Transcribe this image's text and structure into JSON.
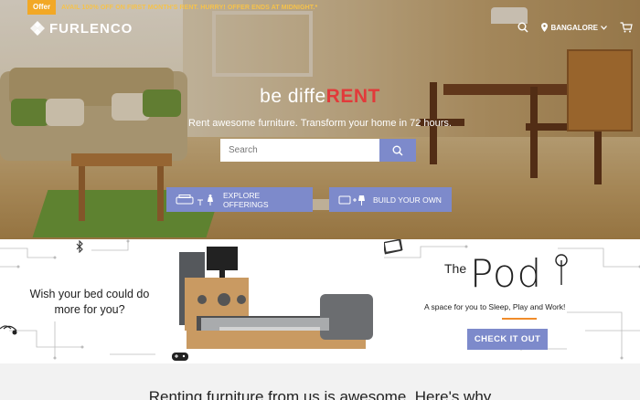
{
  "offer": {
    "tag": "Offer",
    "text": "AVAIL 100% OFF ON FIRST MONTH'S RENT. HURRY! OFFER ENDS AT MIDNIGHT.*"
  },
  "nav": {
    "brand": "FURLENCO",
    "city": "BANGALORE"
  },
  "hero": {
    "tagline_prefix": "be diffe",
    "tagline_highlight": "RENT",
    "subline": "Rent awesome furniture. Transform your home in 72 hours.",
    "search_placeholder": "Search",
    "explore_label": "EXPLORE OFFERINGS",
    "build_label": "BUILD YOUR OWN"
  },
  "promo": {
    "wish_line1": "Wish your bed could do",
    "wish_line2": "more for you?",
    "pod_the": "The",
    "pod_name": "Pod",
    "pod_sub": "A space for you to Sleep, Play and Work!",
    "cta_label": "CHECK IT OUT"
  },
  "teaser": {
    "text": "Renting furniture from us is awesome. Here's why"
  },
  "colors": {
    "accent": "#7d8acb",
    "offer_tag": "#f2a826",
    "highlight": "#e23a3a",
    "pod_line": "#f08c2a"
  }
}
